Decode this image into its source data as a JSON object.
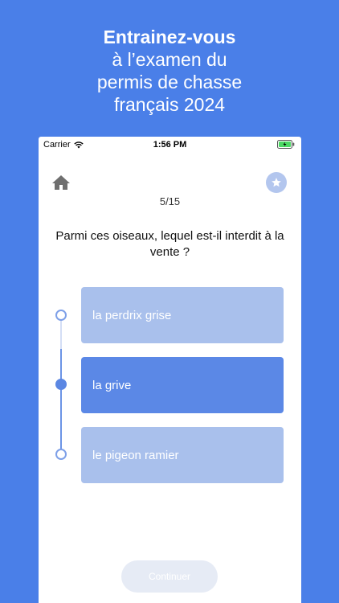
{
  "headline": {
    "line1": "Entrainez-vous",
    "line2": "à l’examen du",
    "line3": "permis de chasse",
    "line4": "français 2024"
  },
  "statusbar": {
    "carrier": "Carrier",
    "time": "1:56 PM"
  },
  "quiz": {
    "counter": "5/15",
    "question": "Parmi ces oiseaux, lequel est-il interdit à la vente ?",
    "options": [
      {
        "label": "la perdrix grise",
        "selected": false
      },
      {
        "label": "la grive",
        "selected": true
      },
      {
        "label": "le pigeon ramier",
        "selected": false
      }
    ],
    "continue_label": "Continuer"
  },
  "colors": {
    "background": "#4a7fe8",
    "option_default": "#a9c0ec",
    "option_selected": "#5b88e6"
  },
  "icons": {
    "home": "home-icon",
    "favorite": "star-icon"
  }
}
